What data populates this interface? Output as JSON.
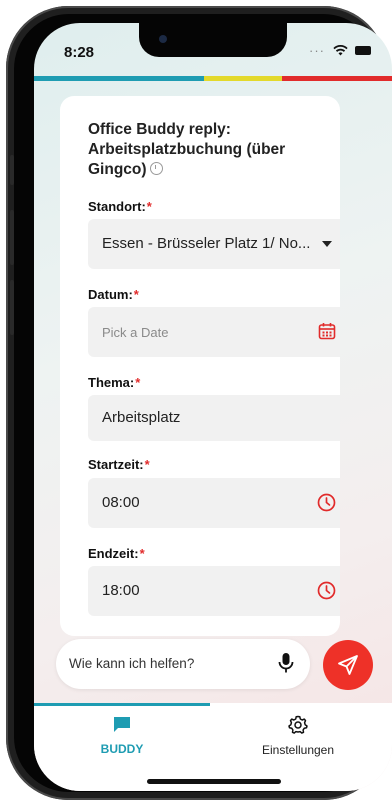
{
  "status": {
    "time": "8:28",
    "icons": "···"
  },
  "accent_colors": {
    "teal": "#1e9cb2",
    "yellow": "#e3d92b",
    "red": "#e12b2b"
  },
  "card": {
    "title": "Office Buddy reply: Arbeitsplatzbuchung (über Gingco)",
    "fields": [
      {
        "label": "Standort:",
        "required_mark": "*",
        "value": "Essen - Brüsseler Platz 1/ No...",
        "type": "dropdown"
      },
      {
        "label": "Datum:",
        "required_mark": "*",
        "placeholder": "Pick a Date",
        "type": "date",
        "icon": "calendar-icon"
      },
      {
        "label": "Thema:",
        "required_mark": "*",
        "value": "Arbeitsplatz",
        "type": "text"
      },
      {
        "label": "Startzeit:",
        "required_mark": "*",
        "value": "08:00",
        "type": "time",
        "icon": "clock-icon"
      },
      {
        "label": "Endzeit:",
        "required_mark": "*",
        "value": "18:00",
        "type": "time",
        "icon": "clock-icon"
      }
    ]
  },
  "composer": {
    "placeholder": "Wie kann ich helfen?"
  },
  "nav": {
    "items": [
      {
        "label": "BUDDY",
        "icon": "chat-icon",
        "active": true
      },
      {
        "label": "Einstellungen",
        "icon": "gear-icon",
        "active": false
      }
    ]
  }
}
